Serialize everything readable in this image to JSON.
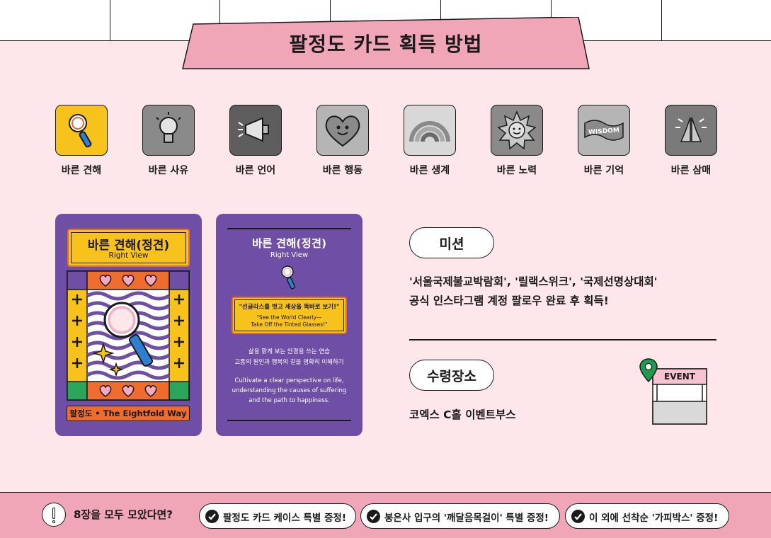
{
  "title": "팔정도 카드 획득 방법",
  "paths": [
    {
      "label": "바른 견해",
      "icon": "magnifier-icon",
      "color": "#f7c21c"
    },
    {
      "label": "바른 사유",
      "icon": "lightbulb-icon",
      "color": "#8a8a8a"
    },
    {
      "label": "바른 언어",
      "icon": "megaphone-icon",
      "color": "#5e5e5e"
    },
    {
      "label": "바른 행동",
      "icon": "heart-icon",
      "color": "#b5b5b5"
    },
    {
      "label": "바른 생계",
      "icon": "rainbow-icon",
      "color": "#d8d8d8"
    },
    {
      "label": "바른 노력",
      "icon": "sun-icon",
      "color": "#8a8a8a"
    },
    {
      "label": "바른 기억",
      "icon": "wisdom-flag-icon",
      "color": "#b5b5b5",
      "flag_text": "WISDOM"
    },
    {
      "label": "바른 삼매",
      "icon": "praying-hands-icon",
      "color": "#7a7a7a"
    }
  ],
  "card_front": {
    "title": "바른 견해(정견)",
    "subtitle": "Right View",
    "footer": "팔정도 • The Eightfold Way"
  },
  "card_back": {
    "title": "바른 견해(정견)",
    "subtitle": "Right View",
    "quote_ko": "\"선글라스를 벗고 세상을 똑바로 보기!\"",
    "quote_en_1": "\"See the World Clearly—",
    "quote_en_2": "Take Off the Tinted Glasses!\"",
    "desc_ko_1": "삶을 맑게 보는 안경을 쓰는 연습",
    "desc_ko_2": "고통의 원인과 행복의 길을 명확히 이해하기",
    "desc_en_1": "Cultivate a clear perspective on life,",
    "desc_en_2": "understanding the causes of suffering",
    "desc_en_3": "and the path to happiness."
  },
  "mission": {
    "label": "미션",
    "line1": "'서울국제불교박람회', '릴랙스위크', '국제선명상대회'",
    "line2": "공식 인스타그램 계정 팔로우 완료 후 획득!"
  },
  "pickup": {
    "label": "수령장소",
    "text": "코엑스 C홀 이벤트부스",
    "booth_sign": "EVENT"
  },
  "bottom": {
    "lead": "8장을 모두 모았다면?",
    "benefits": [
      "팔정도 카드 케이스 특별 증정!",
      "봉은사 입구의 '깨달음목걸이' 특별 증정!",
      "이 외에 선착순 '가피박스' 증정!"
    ]
  },
  "colors": {
    "background": "#fde7ea",
    "banner": "#f1a6b8",
    "card_purple": "#6f4fa5",
    "card_yellow": "#f7c21c",
    "card_orange": "#e66b2a",
    "pin_green": "#1f9a4f"
  }
}
